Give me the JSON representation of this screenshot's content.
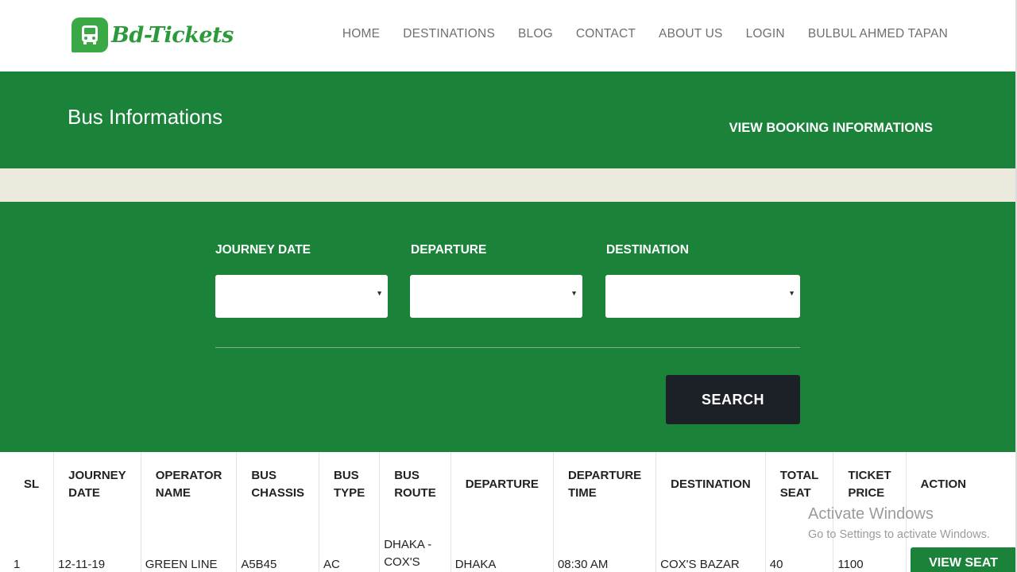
{
  "brand": {
    "name": "Bd-Tickets",
    "color": "#3aa845",
    "icon": "bus-icon"
  },
  "nav": {
    "items": [
      {
        "label": "HOME"
      },
      {
        "label": "DESTINATIONS"
      },
      {
        "label": "BLOG"
      },
      {
        "label": "CONTACT"
      },
      {
        "label": "ABOUT US"
      },
      {
        "label": "LOGIN"
      },
      {
        "label": "BULBUL AHMED TAPAN"
      }
    ]
  },
  "hero": {
    "title": "Bus Informations",
    "link_label": "VIEW BOOKING INFORMATIONS",
    "background": "#1b823a"
  },
  "search": {
    "journey_date_label": "JOURNEY DATE",
    "departure_label": "DEPARTURE",
    "destination_label": "DESTINATION",
    "journey_date_value": "",
    "departure_value": "",
    "destination_value": "",
    "button_label": "SEARCH"
  },
  "table": {
    "columns": [
      [
        "SL"
      ],
      [
        "JOURNEY",
        "DATE"
      ],
      [
        "OPERATOR",
        "NAME"
      ],
      [
        "BUS",
        "CHASSIS"
      ],
      [
        "BUS",
        "TYPE"
      ],
      [
        "BUS",
        "ROUTE"
      ],
      [
        "DEPARTURE"
      ],
      [
        "DEPARTURE",
        "TIME"
      ],
      [
        "DESTINATION"
      ],
      [
        "TOTAL",
        "SEAT"
      ],
      [
        "TICKET",
        "PRICE"
      ],
      [
        "ACTION"
      ]
    ],
    "rows": [
      {
        "sl": "1",
        "journey_date": "12-11-19",
        "operator_name": "GREEN LINE",
        "bus_chassis": "A5B45",
        "bus_type": "AC",
        "bus_route_line1": "DHAKA -",
        "bus_route_line2": "COX'S",
        "departure": "DHAKA",
        "departure_time": "08:30 AM",
        "destination": "COX'S BAZAR",
        "total_seat": "40",
        "ticket_price": "1100",
        "action_label": "VIEW SEAT"
      }
    ]
  },
  "watermark": {
    "title": "Activate Windows",
    "subtitle": "Go to Settings to activate Windows."
  }
}
